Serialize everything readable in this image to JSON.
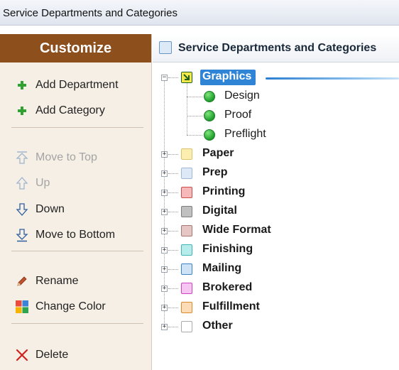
{
  "window": {
    "title": "Service Departments and Categories"
  },
  "sidebar": {
    "header": "Customize",
    "groups": [
      [
        {
          "label": "Add Department",
          "icon": "plus-icon",
          "enabled": true
        },
        {
          "label": "Add Category",
          "icon": "plus-icon",
          "enabled": true
        }
      ],
      [
        {
          "label": "Move to Top",
          "icon": "move-top-icon",
          "enabled": false
        },
        {
          "label": "Up",
          "icon": "arrow-up-icon",
          "enabled": false
        },
        {
          "label": "Down",
          "icon": "arrow-down-icon",
          "enabled": true
        },
        {
          "label": "Move to Bottom",
          "icon": "move-bottom-icon",
          "enabled": true
        }
      ],
      [
        {
          "label": "Rename",
          "icon": "pencil-icon",
          "enabled": true
        },
        {
          "label": "Change Color",
          "icon": "color-palette-icon",
          "enabled": true
        }
      ],
      [
        {
          "label": "Delete",
          "icon": "delete-x-icon",
          "enabled": true
        }
      ]
    ]
  },
  "main": {
    "header": "Service Departments and Categories",
    "tree": [
      {
        "label": "Graphics",
        "color": "#2e8b3a",
        "expanded": true,
        "selected": true,
        "children": [
          "Design",
          "Proof",
          "Preflight"
        ]
      },
      {
        "label": "Paper",
        "color": "#fbeeae",
        "border": "#d9c36b",
        "expanded": false
      },
      {
        "label": "Prep",
        "color": "#dde9f7",
        "border": "#9fb8d6",
        "expanded": false
      },
      {
        "label": "Printing",
        "color": "#f6b8b8",
        "border": "#d04b4b",
        "expanded": false
      },
      {
        "label": "Digital",
        "color": "#c0c0c0",
        "border": "#7d7d7d",
        "expanded": false
      },
      {
        "label": "Wide Format",
        "color": "#e6c6c4",
        "border": "#a57874",
        "expanded": false
      },
      {
        "label": "Finishing",
        "color": "#b7ecec",
        "border": "#3fb6b6",
        "expanded": false
      },
      {
        "label": "Mailing",
        "color": "#cfe3f7",
        "border": "#3a84cc",
        "expanded": false
      },
      {
        "label": "Brokered",
        "color": "#f7c5f1",
        "border": "#cf42c2",
        "expanded": false
      },
      {
        "label": "Fulfillment",
        "color": "#fbdcb7",
        "border": "#dc8a2a",
        "expanded": false
      },
      {
        "label": "Other",
        "color": "#ffffff",
        "border": "#a9a9a9",
        "expanded": false
      }
    ]
  },
  "colors": {
    "sidebar_header_bg": "#8d4f1c",
    "sidebar_bg": "#f6efe6",
    "selection": "#2f84d6",
    "category_dot": "#1f9d2d"
  }
}
